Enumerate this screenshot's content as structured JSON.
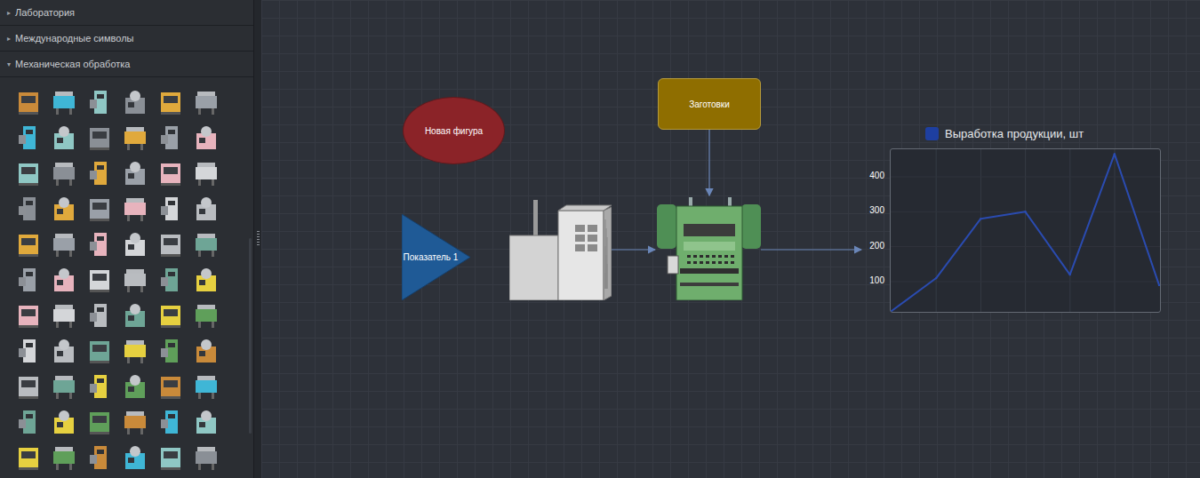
{
  "sidebar": {
    "sections": [
      {
        "label": "Лаборатория",
        "icon": "▸",
        "expanded": false
      },
      {
        "label": "Международные символы",
        "icon": "▸",
        "expanded": false
      },
      {
        "label": "Механическая обработка",
        "icon": "▾",
        "expanded": true
      }
    ]
  },
  "canvas": {
    "nodes": [
      {
        "kind": "ellipse",
        "label": "Новая фигура",
        "color": "#8b2328"
      },
      {
        "kind": "triangle",
        "label": "Показатель 1",
        "color": "#1f5a96"
      },
      {
        "kind": "factory"
      },
      {
        "kind": "box",
        "label": "Заготовки",
        "color": "#8f6e00"
      },
      {
        "kind": "press"
      }
    ]
  },
  "chart": {
    "legend": "Выработка продукции, шт",
    "legend_color": "#1e3fa0",
    "ticks": [
      "400",
      "300",
      "200",
      "100"
    ],
    "series": [
      {
        "name": "Выработка продукции, шт",
        "color": "#2a4bb0",
        "values": [
          12,
          110,
          280,
          300,
          120,
          465,
          90
        ]
      }
    ]
  }
}
